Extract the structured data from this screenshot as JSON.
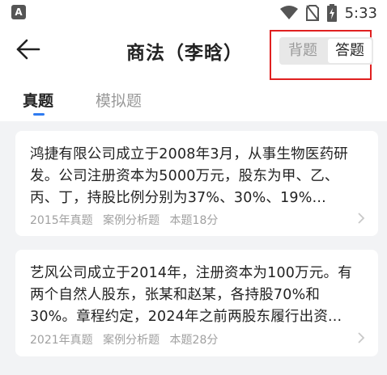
{
  "status_bar": {
    "app_badge": "A",
    "time": "5:33"
  },
  "header": {
    "title": "商法（李晗）",
    "mode_options": [
      "背题",
      "答题"
    ],
    "active_mode": "答题"
  },
  "tabs": [
    {
      "label": "真题",
      "active": true
    },
    {
      "label": "模拟题",
      "active": false
    }
  ],
  "questions": [
    {
      "text": "鸿捷有限公司成立于2008年3月，从事生物医药研发。公司注册资本为5000万元，股东为甲、乙、丙、丁，持股比例分别为37%、30%、19%...",
      "year": "2015年真题",
      "type": "案例分析题",
      "score": "本题18分"
    },
    {
      "text": "艺风公司成立于2014年，注册资本为100万元。有两个自然人股东，张某和赵某，各持股70%和30%。章程约定，2024年之前两股东履行出资...",
      "year": "2021年真题",
      "type": "案例分析题",
      "score": "本题28分"
    }
  ],
  "colors": {
    "accent": "#2f7bf0",
    "highlight": "#e02020",
    "muted": "#a0a0a0"
  }
}
